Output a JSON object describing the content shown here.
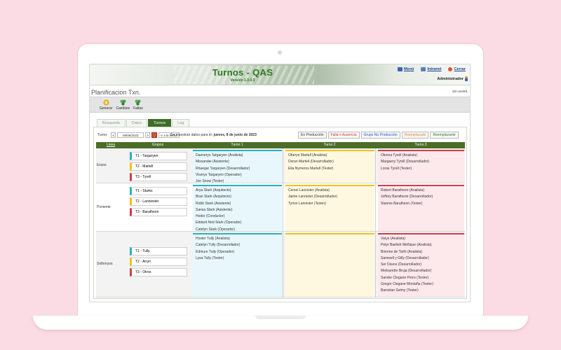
{
  "header": {
    "title": "Turnos - QAS",
    "version": "Versión 1.0.0.0",
    "links": [
      {
        "label": "Menú",
        "icon": "menu-icon"
      },
      {
        "label": "Intranet",
        "icon": "intranet-icon"
      },
      {
        "label": "Cerrar",
        "icon": "close-session-icon"
      }
    ],
    "user": "Administrador"
  },
  "page": {
    "title": "Planificacion Txn.",
    "user_tag": "15\\ cen001"
  },
  "toolbar": [
    {
      "label": "Generar",
      "icon": "generate-icon"
    },
    {
      "label": "Cambios",
      "icon": "changes-icon"
    },
    {
      "label": "Faltas",
      "icon": "absences-icon"
    }
  ],
  "tabs": [
    {
      "label": "Búsqueda",
      "active": false
    },
    {
      "label": "Datos",
      "active": false
    },
    {
      "label": "Turnos",
      "active": true
    },
    {
      "label": "Log",
      "active": false
    }
  ],
  "filter": {
    "label": "Turno:",
    "date": "08/06/2023",
    "prev": "<",
    "next": ">",
    "go_label": "Ir a la fecha",
    "info_prefix": "Se muestran datos para el:",
    "info_date": "jueves, 8 de junio de 2023"
  },
  "legend": [
    {
      "label": "En Producción",
      "color": "#333333",
      "bg": "#f7f7f7"
    },
    {
      "label": "Falta o Ausencia",
      "color": "#d23b3b",
      "bg": "#f7f7f7"
    },
    {
      "label": "Grupo No Producción",
      "color": "#2a4fc4",
      "bg": "#f7f7f7"
    },
    {
      "label": "Reemplazado",
      "color": "#e08a2a",
      "bg": "#f7f7f7"
    },
    {
      "label": "Reemplazante",
      "color": "#2f7a2a",
      "bg": "#f7f7f7"
    }
  ],
  "grid": {
    "headers": {
      "linea": "Linea",
      "grupos": "Grupos",
      "turno1": "Turno 1",
      "turno2": "Turno 2",
      "turno3": "Turno 3"
    },
    "rows": [
      {
        "linea": "Essos",
        "groups": [
          {
            "label": "T1 - Targaryen",
            "color": "#2ab0c4"
          },
          {
            "label": "T2 - Martell",
            "color": "#f0c419"
          },
          {
            "label": "T3 - Tyrell",
            "color": "#d23b4a"
          }
        ],
        "turno1": [
          "Daenerys Targaryen (Analista)",
          "Missandei (Asistente)",
          "Rhaegar Targaryen (Desarrollador)",
          "Viserys Targaryen (Operador)",
          "Jon Snow (Tester)"
        ],
        "turno2": [
          "Oberyn Martell (Analista)",
          "Doran Martell (Desarrollador)",
          "Elia Nymeros Martell (Tester)"
        ],
        "turno3": [
          "Olenna Tyrell (Analista)",
          "Margaery Tyrell (Desarrollador)",
          "Loras Tyrell (Tester)"
        ]
      },
      {
        "linea": "Poniente",
        "groups": [
          {
            "label": "T1 - Starks",
            "color": "#2ab0c4"
          },
          {
            "label": "T2 - Lanniester",
            "color": "#f0c419"
          },
          {
            "label": "T3 - Baratheon",
            "color": "#d23b4a"
          }
        ],
        "turno1": [
          "Arya Stark (Arquitecto)",
          "Bran Stark (Arquitecto)",
          "Robb Stark (Asistente)",
          "Sansa Stark (Asistente)",
          "Hodor (Conductor)",
          "Eddard Ned Stark (Operador)",
          "Catelyn Stark (Operador)"
        ],
        "turno2": [
          "Cersei Lannister (Analista)",
          "Jaime Lannister (Desarrollador)",
          "Tyrion Lannister (Tester)"
        ],
        "turno3": [
          "Robert Baratheon (Analista)",
          "Joffrey Baratheon (Desarrollador)",
          "Stannis Baratheon (Tester)"
        ]
      },
      {
        "linea": "Sothoryos",
        "groups": [
          {
            "label": "T1 - Tully",
            "color": "#2ab0c4"
          },
          {
            "label": "T2 - Arryn",
            "color": "#f0c419"
          },
          {
            "label": "T3 - Otros",
            "color": "#d23b4a"
          }
        ],
        "turno1": [
          "Hoster Tully (Analista)",
          "Catelyn Tully (Desarrollador)",
          "Edmure Tully (Operador)",
          "Lysa Tully (Tester)"
        ],
        "turno2": [],
        "turno3": [
          "Varys (Analista)",
          "Petyr Baelish Meñique (Analista)",
          "Brienne de Tarth (Analista)",
          "Samwell y Gilly (Desarrollador)",
          "Ser Davos (Desarrollador)",
          "Melisandre Bruja (Desarrollador)",
          "Sandor Clegane Perro (Tester)",
          "Gregor Clegane Montaña (Tester)",
          "Barristan Selmy (Tester)"
        ]
      }
    ]
  },
  "colors": {
    "turno1_bar": "#2ab0c4",
    "turno1_bg": "#e8f7fb",
    "turno2_bar": "#f0c419",
    "turno2_bg": "#fff8e1",
    "turno3_bar": "#d23b4a",
    "turno3_bg": "#fde8ec",
    "header_green": "#4b6d28"
  }
}
